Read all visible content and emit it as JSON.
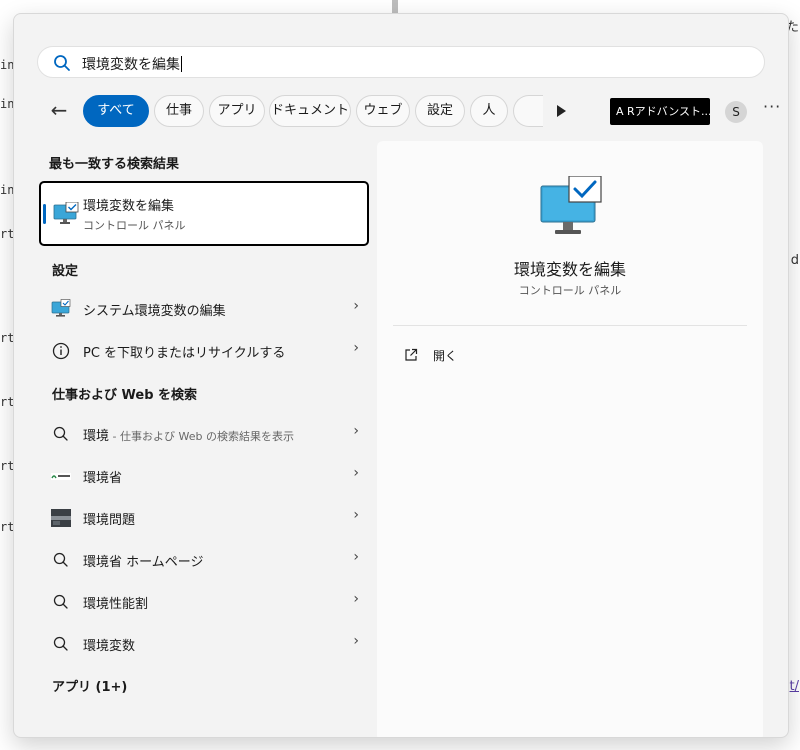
{
  "background": {
    "left_lines": [
      {
        "text": "in"
      },
      {
        "text": "in"
      },
      {
        "text": "in"
      },
      {
        "text": "rt"
      },
      {
        "text": "rt"
      },
      {
        "text": "rt"
      },
      {
        "text": "rt"
      },
      {
        "text": "rt"
      }
    ],
    "right_lines": [
      {
        "text": "た"
      },
      {
        "text": "d"
      },
      {
        "text": "t/"
      }
    ]
  },
  "search": {
    "query": "環境変数を編集"
  },
  "filters": {
    "chips": [
      {
        "label": "すべて",
        "active": true
      },
      {
        "label": "仕事",
        "active": false
      },
      {
        "label": "アプリ",
        "active": false
      },
      {
        "label": "ドキュメント",
        "active": false
      },
      {
        "label": "ウェブ",
        "active": false
      },
      {
        "label": "設定",
        "active": false
      },
      {
        "label": "人",
        "active": false
      }
    ],
    "banner": "A Rアドバンスト...",
    "avatar": "S",
    "more": "···"
  },
  "best_match": {
    "heading": "最も一致する検索結果",
    "title": "環境変数を編集",
    "subtitle": "コントロール パネル"
  },
  "settings": {
    "heading": "設定",
    "items": [
      {
        "label": "システム環境変数の編集",
        "icon": "monitor-icon"
      },
      {
        "label": "PC を下取りまたはリサイクルする",
        "icon": "info-icon"
      }
    ]
  },
  "web": {
    "heading": "仕事および Web を検索",
    "items": [
      {
        "label": "環境",
        "sub": " - 仕事および Web の検索結果を表示",
        "icon": "search-icon"
      },
      {
        "label": "環境省",
        "sub": "",
        "icon": "ministry-logo-icon"
      },
      {
        "label": "環境問題",
        "sub": "",
        "icon": "thumbnail-icon"
      },
      {
        "label": "環境省 ホームページ",
        "sub": "",
        "icon": "search-icon"
      },
      {
        "label": "環境性能割",
        "sub": "",
        "icon": "search-icon"
      },
      {
        "label": "環境変数",
        "sub": "",
        "icon": "search-icon"
      }
    ]
  },
  "apps": {
    "heading": "アプリ (1+)"
  },
  "preview": {
    "title": "環境変数を編集",
    "subtitle": "コントロール パネル",
    "open_label": "開く"
  },
  "colors": {
    "accent": "#0067c0",
    "panel": "#f3f3f3"
  }
}
